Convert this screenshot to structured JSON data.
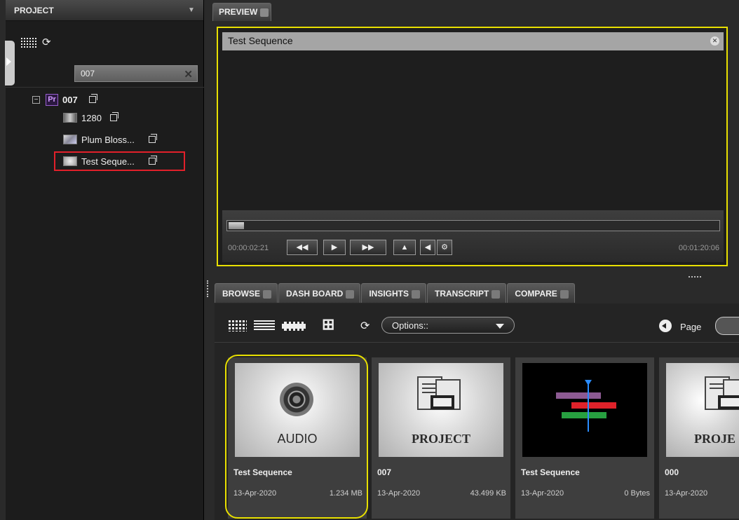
{
  "project_panel": {
    "header": "PROJECT",
    "search_value": "007",
    "tree": [
      {
        "label": "007",
        "badge": "Pr"
      },
      {
        "label": "1280"
      },
      {
        "label": "Plum Bloss..."
      },
      {
        "label": "Test Seque..."
      }
    ]
  },
  "preview": {
    "tab_label": "PREVIEW",
    "title": "Test Sequence",
    "timecode_current": "00:00:02:21",
    "timecode_total": "00:01:20:06"
  },
  "browse_tabs": [
    "BROWSE",
    "DASH BOARD",
    "INSIGHTS",
    "TRANSCRIPT",
    "COMPARE"
  ],
  "toolbar": {
    "options_label": "Options::",
    "page_label": "Page"
  },
  "cards": [
    {
      "thumb_label": "AUDIO",
      "name": "Test Sequence",
      "date": "13-Apr-2020",
      "size": "1.234 MB"
    },
    {
      "thumb_label": "PROJECT",
      "name": "007",
      "date": "13-Apr-2020",
      "size": "43.499 KB"
    },
    {
      "thumb_label": "",
      "name": "Test Sequence",
      "date": "13-Apr-2020",
      "size": "0 Bytes"
    },
    {
      "thumb_label": "PROJE",
      "name": "000",
      "date": "13-Apr-2020",
      "size": ""
    }
  ],
  "colors": {
    "highlight_yellow": "#e8e000",
    "selection_red": "#e2202a",
    "premiere_purple": "#9a5fd0"
  }
}
